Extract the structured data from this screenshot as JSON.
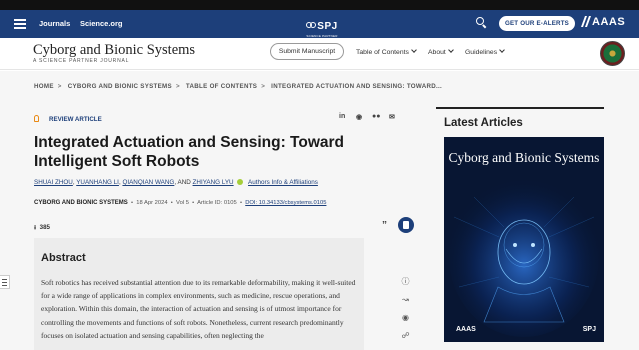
{
  "nav": {
    "links": [
      "Journals",
      "Science.org"
    ],
    "logo_text": "SPJ",
    "logo_sub": "SCIENCE PARTNER JOURNALS",
    "alerts_label": "GET OUR E-ALERTS",
    "aaas_label": "AAAS"
  },
  "journal": {
    "title": "Cyborg and Bionic Systems",
    "subtitle": "A SCIENCE PARTNER JOURNAL",
    "submit_label": "Submit Manuscript",
    "menu": [
      "Table of Contents",
      "About",
      "Guidelines"
    ]
  },
  "breadcrumb": [
    "HOME",
    "CYBORG AND BIONIC SYSTEMS",
    "TABLE OF CONTENTS",
    "INTEGRATED ACTUATION AND SENSING: TOWARD..."
  ],
  "article": {
    "type_label": "REVIEW ARTICLE",
    "title": "Integrated Actuation and Sensing: Toward Intelligent Soft Robots",
    "authors": [
      "SHUAI ZHOU",
      "YUANHANG LI",
      "QIANQIAN WANG",
      "AND",
      "ZHIYANG LYU"
    ],
    "author_info_label": "Authors Info & Affiliations",
    "journal_name": "CYBORG AND BIONIC SYSTEMS",
    "date": "18 Apr 2024",
    "volume": "Vol 5",
    "article_id": "Article ID: 0105",
    "doi": "DOI: 10.34133/cbsystems.0105",
    "downloads": "385",
    "share_icons": [
      "linkedin-icon",
      "reddit-icon",
      "wechat-icon",
      "email-icon"
    ]
  },
  "abstract": {
    "heading": "Abstract",
    "text": "Soft robotics has received substantial attention due to its remarkable deformability, making it well-suited for a wide range of applications in complex environments, such as medicine, rescue operations, and exploration. Within this domain, the interaction of actuation and sensing is of utmost importance for controlling the movements and functions of soft robots. Nonetheless, current research predominantly focuses on isolated actuation and sensing capabilities, often neglecting the"
  },
  "sidebar": {
    "heading": "Latest Articles",
    "cover_title": "Cyborg and Bionic Systems",
    "cover_footer_left": "AAAS",
    "cover_footer_right": "SPJ"
  },
  "colors": {
    "brand_navy": "#1d3f7a",
    "orange_accent": "#e98a15",
    "cover_bg": "#081633",
    "orcid_green": "#a6ce39"
  }
}
